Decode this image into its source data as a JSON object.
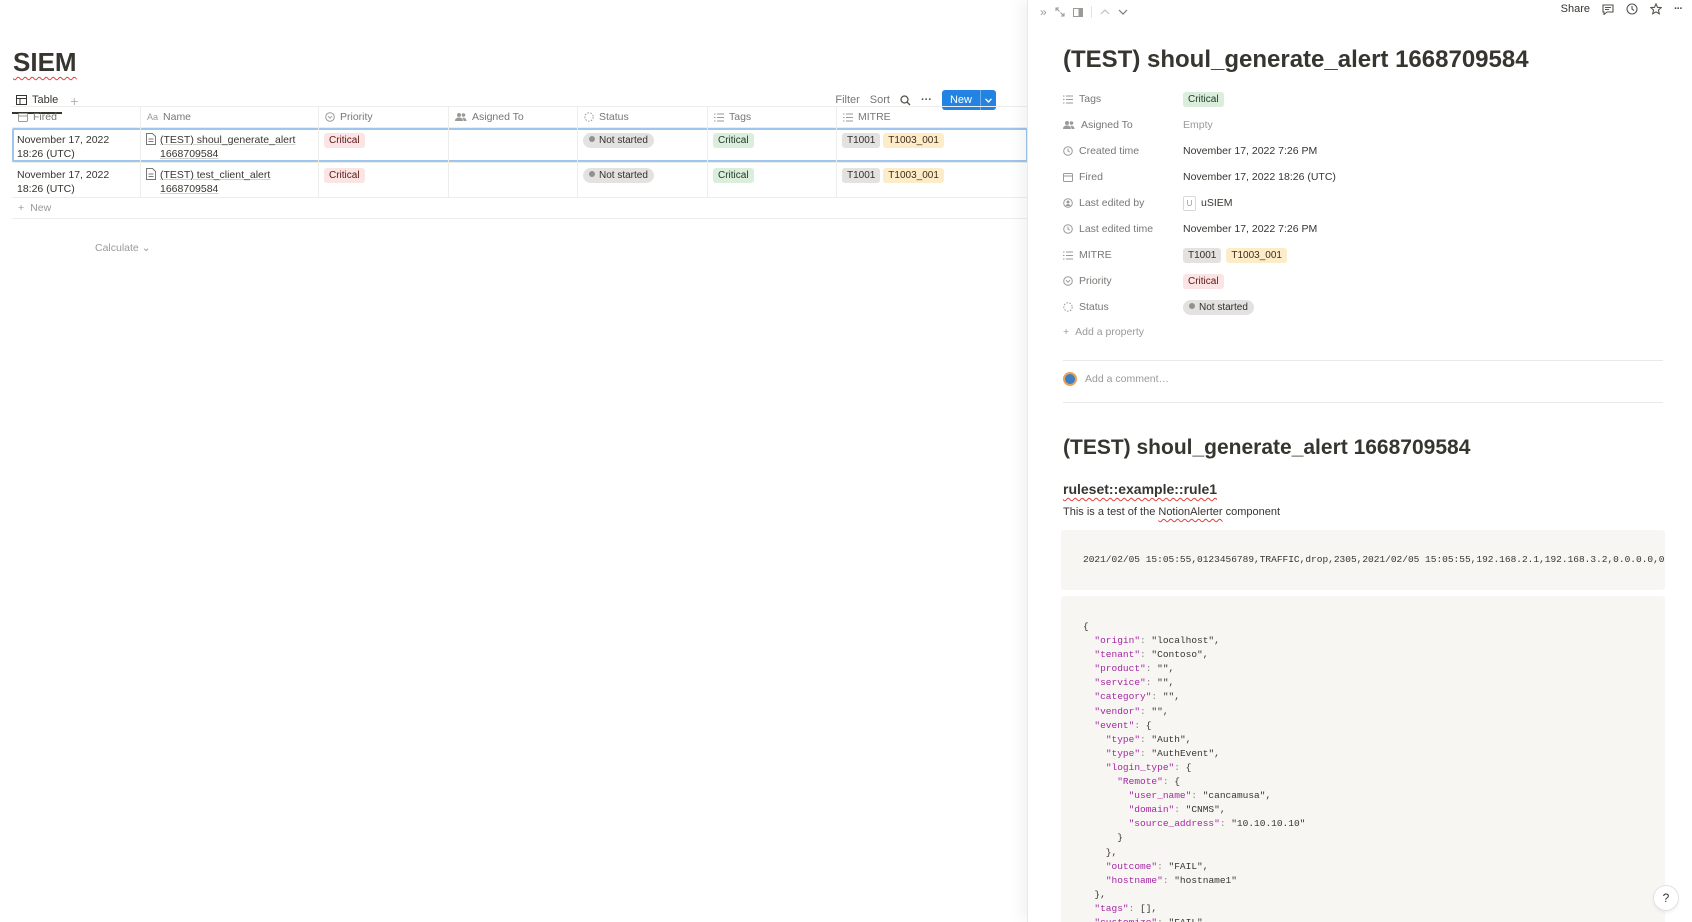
{
  "page": {
    "title": "SIEM"
  },
  "views": {
    "active_tab": "Table",
    "add": "+"
  },
  "toolbar": {
    "filter": "Filter",
    "sort": "Sort",
    "more": "···",
    "new": "New"
  },
  "table": {
    "columns": [
      "Fired",
      "Name",
      "Priority",
      "Asigned To",
      "Status",
      "Tags",
      "MITRE"
    ],
    "rows": [
      {
        "fired": "November 17, 2022 18:26 (UTC)",
        "name": "(TEST) shoul_generate_alert 1668709584",
        "priority": "Critical",
        "assigned": "",
        "status": "Not started",
        "tags": "Critical",
        "mitre1": "T1001",
        "mitre2": "T1003_001"
      },
      {
        "fired": "November 17, 2022 18:26 (UTC)",
        "name": "(TEST) test_client_alert 1668709584",
        "priority": "Critical",
        "assigned": "",
        "status": "Not started",
        "tags": "Critical",
        "mitre1": "T1001",
        "mitre2": "T1003_001"
      }
    ],
    "new_row": "New",
    "calculate": "Calculate"
  },
  "peek": {
    "share": "Share",
    "title": "(TEST) shoul_generate_alert 1668709584",
    "properties": [
      {
        "name": "Tags",
        "value": "Critical"
      },
      {
        "name": "Asigned To",
        "value": "Empty"
      },
      {
        "name": "Created time",
        "value": "November 17, 2022 7:26 PM"
      },
      {
        "name": "Fired",
        "value": "November 17, 2022 18:26 (UTC)"
      },
      {
        "name": "Last edited by",
        "value": "uSIEM",
        "avatar": "U"
      },
      {
        "name": "Last edited time",
        "value": "November 17, 2022 7:26 PM"
      },
      {
        "name": "MITRE",
        "value": "T1001",
        "value2": "T1003_001"
      },
      {
        "name": "Priority",
        "value": "Critical"
      },
      {
        "name": "Status",
        "value": "Not started"
      }
    ],
    "add_property": "Add a property",
    "comment_placeholder": "Add a comment…",
    "body_heading": "(TEST) shoul_generate_alert 1668709584",
    "rule_heading": "ruleset::example::rule1",
    "description": {
      "before": "This is a test of the ",
      "link": "NotionAlerter",
      "after": " component"
    },
    "log_line": "2021/02/05 15:05:55,0123456789,TRAFFIC,drop,2305,2021/02/05 15:05:55,192.168.2.1,192.168.3.2,0.0.0.0,0",
    "json_lines": [
      "{",
      "  \"origin\": \"localhost\",",
      "  \"tenant\": \"Contoso\",",
      "  \"product\": \"\",",
      "  \"service\": \"\",",
      "  \"category\": \"\",",
      "  \"vendor\": \"\",",
      "  \"event\": {",
      "    \"type\": \"Auth\",",
      "    \"type\": \"AuthEvent\",",
      "    \"login_type\": {",
      "      \"Remote\": {",
      "        \"user_name\": \"cancamusa\",",
      "        \"domain\": \"CNMS\",",
      "        \"source_address\": \"10.10.10.10\"",
      "      }",
      "    },",
      "    \"outcome\": \"FAIL\",",
      "    \"hostname\": \"hostname1\"",
      "  },",
      "  \"tags\": [],",
      "  \"customize\": \"FAIL\""
    ],
    "help": "?"
  },
  "colors": {
    "accent": "#2383e2",
    "critical_bg": "#fbe4e4",
    "tag_green_bg": "#dbeddb",
    "mitre_orange_bg": "#fdecc8"
  }
}
